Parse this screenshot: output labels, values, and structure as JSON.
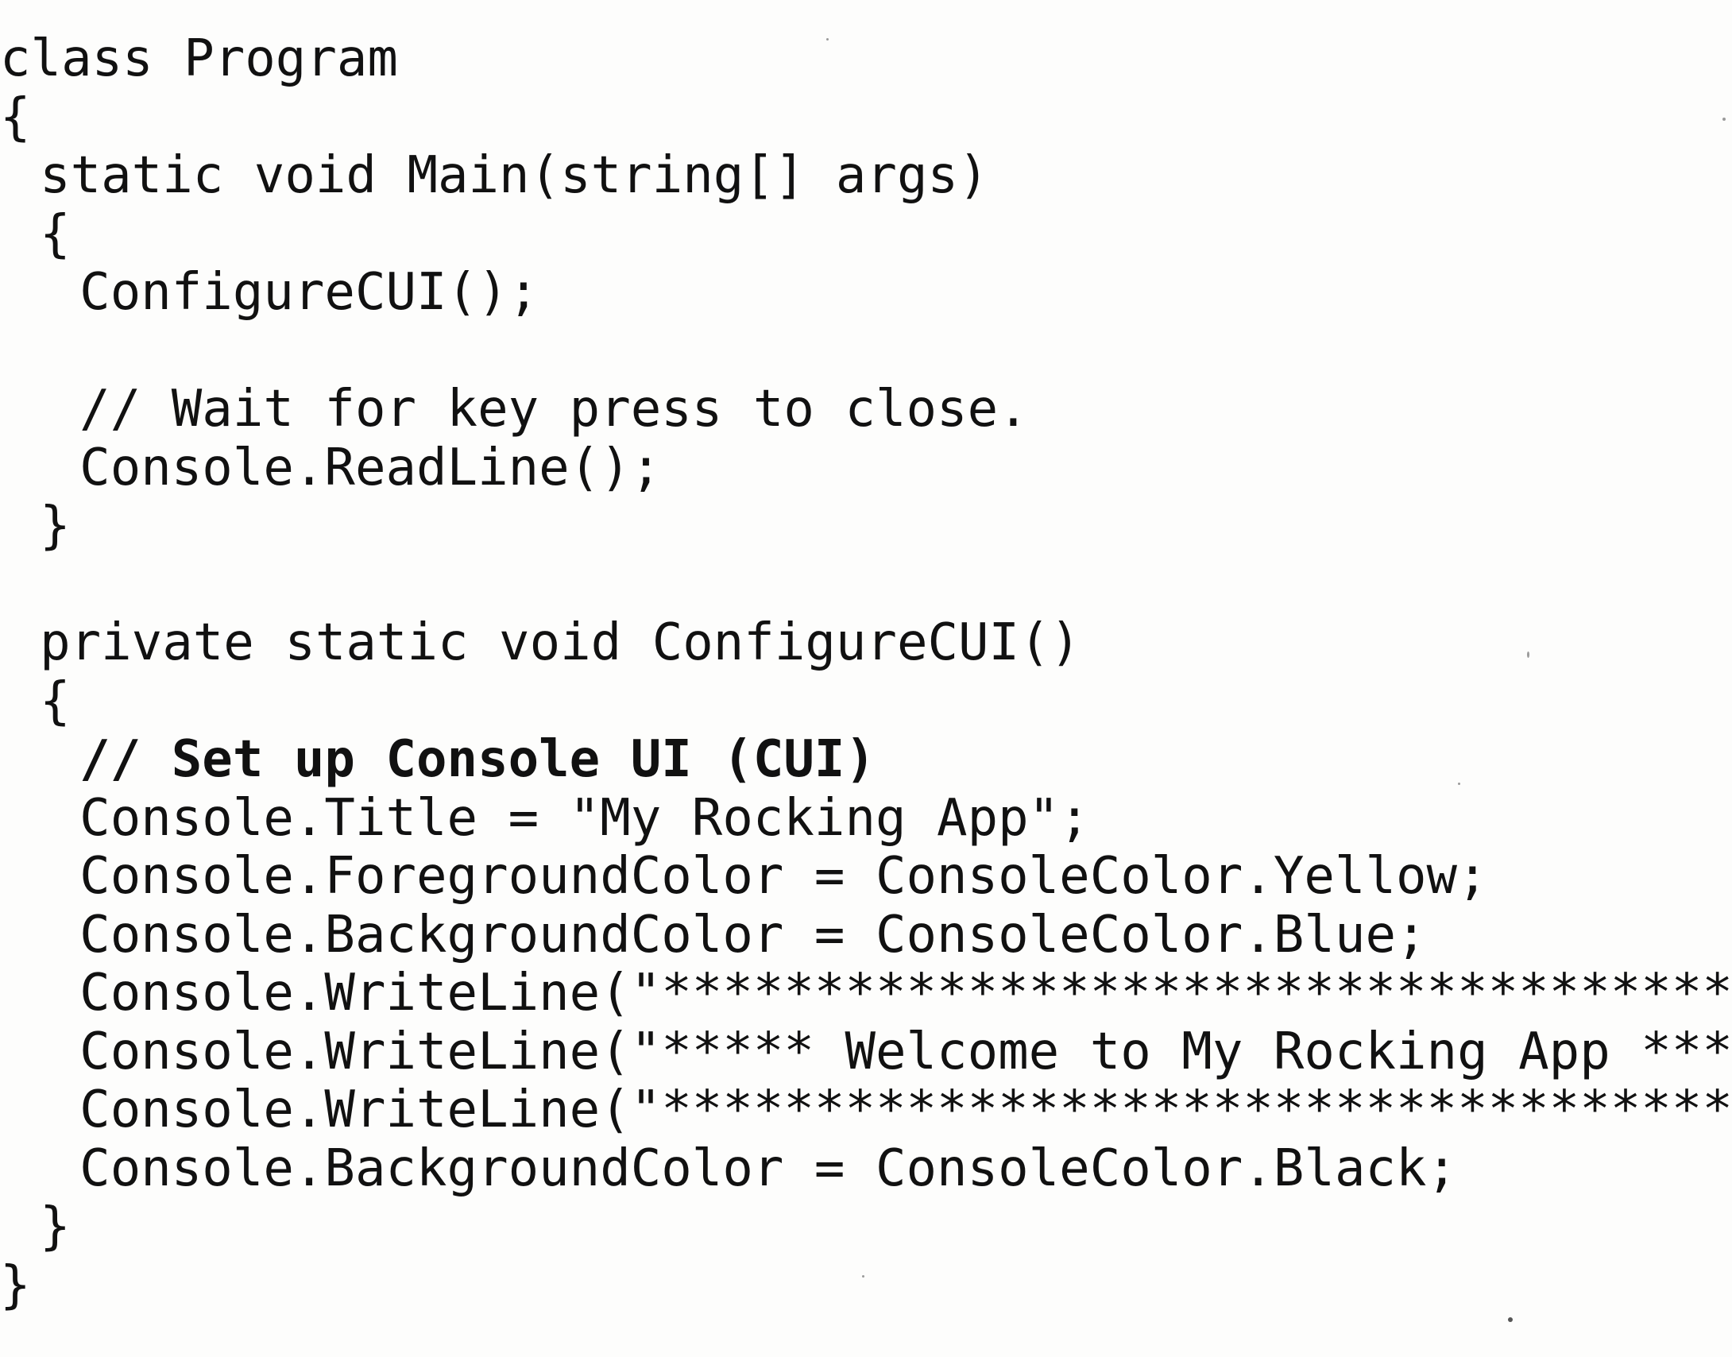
{
  "code": {
    "lines": [
      {
        "indent": 0,
        "text": "class Program",
        "bold": false
      },
      {
        "indent": 0,
        "text": "{",
        "bold": false
      },
      {
        "indent": 1,
        "text": "static void Main(string[] args)",
        "bold": false
      },
      {
        "indent": 1,
        "text": "{",
        "bold": false
      },
      {
        "indent": 2,
        "text": "ConfigureCUI();",
        "bold": false
      },
      {
        "indent": 0,
        "text": "",
        "bold": false
      },
      {
        "indent": 2,
        "text": "// Wait for key press to close.",
        "bold": false
      },
      {
        "indent": 2,
        "text": "Console.ReadLine();",
        "bold": false
      },
      {
        "indent": 1,
        "text": "}",
        "bold": false
      },
      {
        "indent": 0,
        "text": "",
        "bold": false
      },
      {
        "indent": 1,
        "text": "private static void ConfigureCUI()",
        "bold": false
      },
      {
        "indent": 1,
        "text": "{",
        "bold": false
      },
      {
        "indent": 2,
        "text": "// Set up Console UI (CUI)",
        "bold": true
      },
      {
        "indent": 2,
        "text": "Console.Title = \"My Rocking App\";",
        "bold": false
      },
      {
        "indent": 2,
        "text": "Console.ForegroundColor = ConsoleColor.Yellow;",
        "bold": false
      },
      {
        "indent": 2,
        "text": "Console.BackgroundColor = ConsoleColor.Blue;",
        "bold": false
      },
      {
        "indent": 2,
        "text": "Console.WriteLine(\"*************************************\");",
        "bold": false
      },
      {
        "indent": 2,
        "text": "Console.WriteLine(\"***** Welcome to My Rocking App *****\");",
        "bold": false
      },
      {
        "indent": 2,
        "text": "Console.WriteLine(\"*************************************\");",
        "bold": false
      },
      {
        "indent": 2,
        "text": "Console.BackgroundColor = ConsoleColor.Black;",
        "bold": false
      },
      {
        "indent": 1,
        "text": "}",
        "bold": false
      },
      {
        "indent": 0,
        "text": "}",
        "bold": false
      }
    ]
  }
}
